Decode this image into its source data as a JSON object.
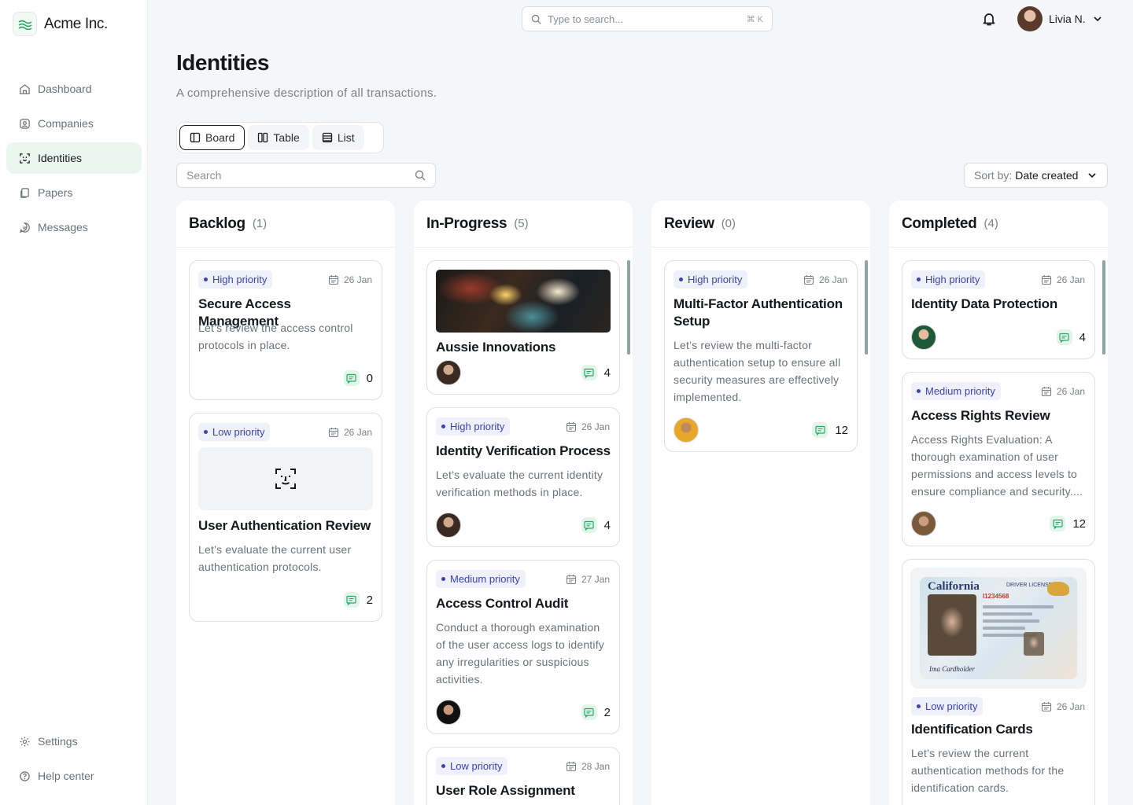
{
  "brand": {
    "name": "Acme Inc."
  },
  "sidebar": {
    "items": [
      {
        "label": "Dashboard",
        "icon": "home-icon"
      },
      {
        "label": "Companies",
        "icon": "companies-icon"
      },
      {
        "label": "Identities",
        "icon": "scan-face-icon",
        "active": true
      },
      {
        "label": "Papers",
        "icon": "papers-icon"
      },
      {
        "label": "Messages",
        "icon": "message-icon"
      }
    ],
    "bottom": [
      {
        "label": "Settings",
        "icon": "gear-icon"
      },
      {
        "label": "Help center",
        "icon": "help-icon"
      }
    ]
  },
  "topbar": {
    "search_placeholder": "Type to search...",
    "shortcut": "⌘ K",
    "user_name": "Livia N."
  },
  "page": {
    "title": "Identities",
    "subtitle": "A comprehensive description of all transactions."
  },
  "views": {
    "board": "Board",
    "table": "Table",
    "list": "List",
    "active": "Board"
  },
  "filter": {
    "placeholder": "Search"
  },
  "sort": {
    "label": "Sort by:",
    "value": "Date created"
  },
  "columns": [
    {
      "title": "Backlog",
      "count": "(1)",
      "cards": [
        {
          "priority": "High priority",
          "date": "26 Jan",
          "title": "Secure Access Management",
          "desc": "Let’s review the access control protocols in place.",
          "comments": "0"
        },
        {
          "priority": "Low priority",
          "date": "26 Jan",
          "title": "User Authentication Review",
          "desc": "Let’s evaluate the current user authentication protocols.",
          "comments": "2"
        }
      ]
    },
    {
      "title": "In-Progress",
      "count": "(5)",
      "cards": [
        {
          "title": "Aussie Innovations",
          "comments": "4"
        },
        {
          "priority": "High priority",
          "date": "26 Jan",
          "title": "Identity Verification Process",
          "desc": "Let’s evaluate the current identity verification methods in place.",
          "comments": "4"
        },
        {
          "priority": "Medium priority",
          "date": "27 Jan",
          "title": "Access Control Audit",
          "desc": "Conduct a thorough examination of the user access logs to identify any irregularities or suspicious activities.",
          "comments": "2"
        },
        {
          "priority": "Low priority",
          "date": "28 Jan",
          "title": "User Role Assignment"
        }
      ]
    },
    {
      "title": "Review",
      "count": "(0)",
      "cards": [
        {
          "priority": "High priority",
          "date": "26 Jan",
          "title": "Multi-Factor Authentication Setup",
          "desc": "Let’s review the multi-factor authentication setup to ensure all security measures are effectively implemented.",
          "comments": "12"
        }
      ]
    },
    {
      "title": "Completed",
      "count": "(4)",
      "cards": [
        {
          "priority": "High priority",
          "date": "26 Jan",
          "title": "Identity Data Protection",
          "comments": "4"
        },
        {
          "priority": "Medium priority",
          "date": "26 Jan",
          "title": "Access Rights Review",
          "desc": "Access Rights Evaluation: A thorough examination of user permissions and access levels to ensure compliance and security....",
          "comments": "12"
        },
        {
          "priority": "Low priority",
          "date": "26 Jan",
          "title": "Identification Cards",
          "desc": "Let’s review the current authentication methods for the identification cards."
        }
      ]
    }
  ],
  "license": {
    "state": "California",
    "type": "DRIVER LICENSE",
    "number": "I1234568",
    "signature": "Ima Cardholder"
  },
  "colors": {
    "accent": "#3a43b0",
    "badge_bg": "#eff0fa",
    "comment_bg": "#e2f5ea",
    "active_nav": "#ecf6f0"
  }
}
